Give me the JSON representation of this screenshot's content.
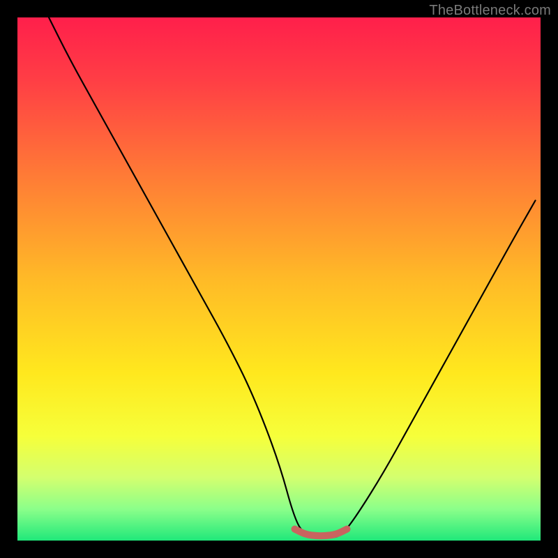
{
  "watermark": "TheBottleneck.com",
  "chart_data": {
    "type": "line",
    "title": "",
    "xlabel": "",
    "ylabel": "",
    "xlim": [
      0,
      100
    ],
    "ylim": [
      0,
      100
    ],
    "grid": false,
    "legend": false,
    "series": [
      {
        "name": "bottleneck-curve",
        "x": [
          6,
          10,
          15,
          20,
          25,
          30,
          35,
          40,
          45,
          50,
          53,
          55,
          57,
          60,
          62,
          65,
          70,
          75,
          80,
          85,
          90,
          95,
          99
        ],
        "y": [
          100,
          92,
          83,
          74,
          65,
          56,
          47,
          38,
          28,
          15,
          4,
          1,
          0.5,
          0.5,
          1,
          5,
          13,
          22,
          31,
          40,
          49,
          58,
          65
        ]
      },
      {
        "name": "optimal-range-marker",
        "x": [
          53,
          55,
          57,
          59,
          61,
          63
        ],
        "y": [
          2.2,
          1.2,
          0.9,
          0.9,
          1.2,
          2.2
        ]
      }
    ],
    "background_gradient_stops": [
      {
        "pct": 0,
        "color": "#ff1f4b"
      },
      {
        "pct": 12,
        "color": "#ff3e45"
      },
      {
        "pct": 30,
        "color": "#ff7a36"
      },
      {
        "pct": 50,
        "color": "#ffba27"
      },
      {
        "pct": 68,
        "color": "#ffe81e"
      },
      {
        "pct": 80,
        "color": "#f6ff3a"
      },
      {
        "pct": 88,
        "color": "#d3ff6f"
      },
      {
        "pct": 94,
        "color": "#8bff8a"
      },
      {
        "pct": 100,
        "color": "#20e87a"
      }
    ],
    "marker_color": "#c9645f",
    "curve_color": "#000000"
  },
  "layout": {
    "stage": 800,
    "plot_inset": 25,
    "plot_size": 750
  }
}
